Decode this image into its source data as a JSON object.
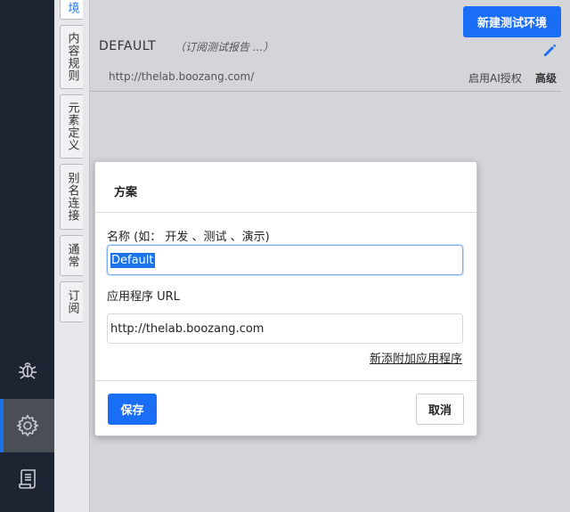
{
  "sidebar": {
    "items": [
      {
        "icon": "bug-icon"
      },
      {
        "icon": "gear-icon",
        "active": true
      },
      {
        "icon": "scroll-icon"
      }
    ],
    "accent_color": "#1a73e8"
  },
  "tabs": [
    {
      "label": "境"
    },
    {
      "label": "内容规则"
    },
    {
      "label": "元素定义"
    },
    {
      "label": "别名连接"
    },
    {
      "label": "通常"
    },
    {
      "label": "订阅"
    }
  ],
  "header": {
    "env_name": "DEFAULT",
    "env_subtitle": "（订阅测试报告 ...）",
    "new_env_button": "新建测试环境",
    "env_url": "http://thelab.boozang.com/",
    "ai_auth": "启用AI授权",
    "advanced": "高级"
  },
  "modal": {
    "title": "方案",
    "name_label": "名称 (如： 开发 、测试 、演示)",
    "name_value": "Default",
    "url_label": "应用程序 URL",
    "url_value": "http://thelab.boozang.com",
    "add_app_link": "新添附加应用程序",
    "save_button": "保存",
    "cancel_button": "取消"
  },
  "colors": {
    "primary": "#1a6ef5",
    "sidebar_bg": "#1d2431",
    "page_bg": "#d4d5d9"
  }
}
